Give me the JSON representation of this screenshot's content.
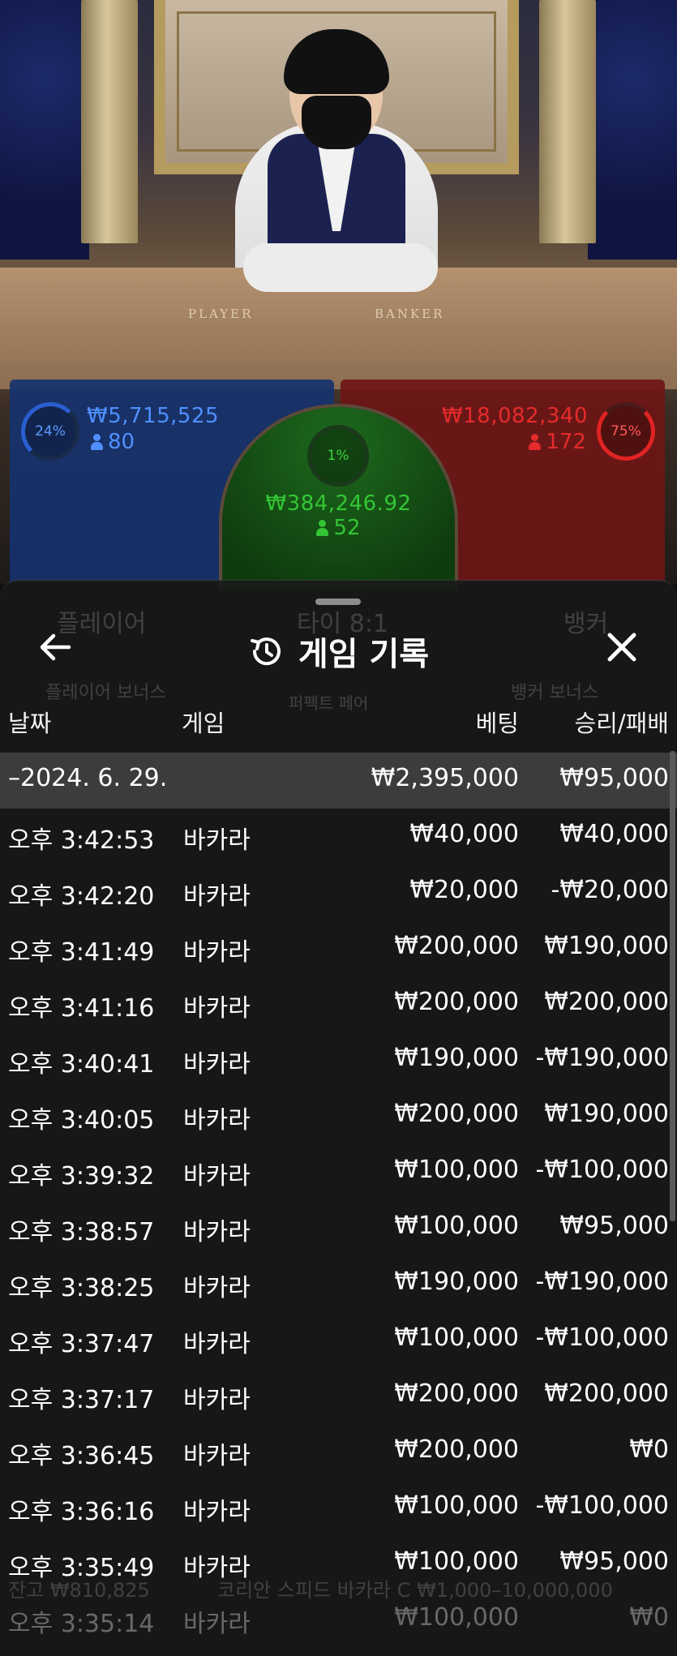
{
  "table_scene": {
    "player_label": "PLAYER",
    "banker_label": "BANKER"
  },
  "bets": {
    "player": {
      "percent": "24%",
      "amount": "₩5,715,525",
      "players": "80",
      "color": "#4f8fff"
    },
    "tie": {
      "percent": "1%",
      "amount": "₩384,246.92",
      "players": "52",
      "color": "#34c534"
    },
    "banker": {
      "percent": "75%",
      "amount": "₩18,082,340",
      "players": "172",
      "color": "#e42b2b"
    }
  },
  "sheet": {
    "title": "게임 기록",
    "icons": {
      "back": "arrow-left-icon",
      "history": "history-clock-icon",
      "close": "close-icon"
    },
    "columns": {
      "date": "날짜",
      "game": "게임",
      "bet": "베팅",
      "result": "승리/패배"
    },
    "summary": {
      "date": "–2024. 6. 29.",
      "bet": "₩2,395,000",
      "result": "₩95,000"
    },
    "rows": [
      {
        "time": "오후 3:42:53",
        "game": "바카라",
        "bet": "₩40,000",
        "result": "₩40,000"
      },
      {
        "time": "오후 3:42:20",
        "game": "바카라",
        "bet": "₩20,000",
        "result": "-₩20,000"
      },
      {
        "time": "오후 3:41:49",
        "game": "바카라",
        "bet": "₩200,000",
        "result": "₩190,000"
      },
      {
        "time": "오후 3:41:16",
        "game": "바카라",
        "bet": "₩200,000",
        "result": "₩200,000"
      },
      {
        "time": "오후 3:40:41",
        "game": "바카라",
        "bet": "₩190,000",
        "result": "-₩190,000"
      },
      {
        "time": "오후 3:40:05",
        "game": "바카라",
        "bet": "₩200,000",
        "result": "₩190,000"
      },
      {
        "time": "오후 3:39:32",
        "game": "바카라",
        "bet": "₩100,000",
        "result": "-₩100,000"
      },
      {
        "time": "오후 3:38:57",
        "game": "바카라",
        "bet": "₩100,000",
        "result": "₩95,000"
      },
      {
        "time": "오후 3:38:25",
        "game": "바카라",
        "bet": "₩190,000",
        "result": "-₩190,000"
      },
      {
        "time": "오후 3:37:47",
        "game": "바카라",
        "bet": "₩100,000",
        "result": "-₩100,000"
      },
      {
        "time": "오후 3:37:17",
        "game": "바카라",
        "bet": "₩200,000",
        "result": "₩200,000"
      },
      {
        "time": "오후 3:36:45",
        "game": "바카라",
        "bet": "₩200,000",
        "result": "₩0"
      },
      {
        "time": "오후 3:36:16",
        "game": "바카라",
        "bet": "₩100,000",
        "result": "-₩100,000"
      },
      {
        "time": "오후 3:35:49",
        "game": "바카라",
        "bet": "₩100,000",
        "result": "₩95,000"
      },
      {
        "time": "오후 3:35:14",
        "game": "바카라",
        "bet": "₩100,000",
        "result": "₩0"
      }
    ]
  },
  "background_ghost": {
    "player_title": "플레이어",
    "tie_title": "타이 8:1",
    "banker_title": "뱅커",
    "player_bonus": "플레이어 보너스",
    "perfect_pair": "퍼펙트 페어",
    "banker_bonus": "뱅커 보너스",
    "bottom_info": "잔고 ₩810,825",
    "table_name": "코리안 스피드 바카라 C ₩1,000–10,000,000"
  }
}
